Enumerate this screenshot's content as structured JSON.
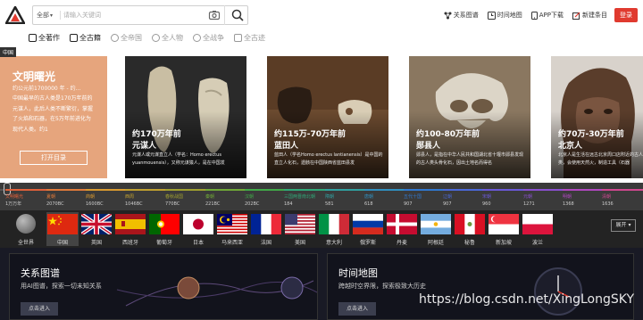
{
  "header": {
    "search": {
      "scope": "全部",
      "placeholder": "请输入关键词"
    },
    "nav": [
      {
        "label": "关系图谱",
        "icon": "graph-icon"
      },
      {
        "label": "时间地图",
        "icon": "clock-map-icon"
      },
      {
        "label": "APP下载",
        "icon": "phone-icon"
      },
      {
        "label": "新建条目",
        "icon": "edit-icon"
      }
    ],
    "login": "登录"
  },
  "filters": [
    {
      "label": "全著作",
      "active": true
    },
    {
      "label": "全古籍",
      "active": true
    },
    {
      "label": "全帝国",
      "active": false
    },
    {
      "label": "全人物",
      "active": false
    },
    {
      "label": "全战争",
      "active": false
    },
    {
      "label": "全古迹",
      "active": false
    }
  ],
  "region_tag": "中国",
  "feature": {
    "title": "文明曙光",
    "date": "约公元前1700000 年 - 约...",
    "desc": "中国最早的古人类是170万年前的元谋人，此后人类不断繁衍，掌握了火焰和石器，在5万年前进化为现代人类。约1",
    "button": "打开目录"
  },
  "cards": [
    {
      "time": "约170万年前",
      "name": "元谋人",
      "desc": "元谋人或元谋直立人（学名：Homo erectus yuanmouensis），又称元谋猿人，是在中国发"
    },
    {
      "time": "约115万-70万年前",
      "name": "蓝田人",
      "desc": "蓝田人（学名Homo erectus lantianensis）是中国的直立人化石，遗骸在中国陕西省蓝田县发"
    },
    {
      "time": "约100-80万年前",
      "name": "郧县人",
      "desc": "郧县人，是指在中华人民共和国湖北省十堰市郧县发现的古人类头骨化石，因出土地名而得名"
    },
    {
      "time": "约70万-30万年前",
      "name": "北京人",
      "desc": "北京人是生活在远古北京周口店附近的古人类，会使用天然火，制造工具（石器"
    }
  ],
  "timeline": [
    {
      "name": "文明曙光",
      "year": "1万万年",
      "color": "#e0603a"
    },
    {
      "name": "夏朝",
      "year": "2070BC",
      "color": "#e07a3a"
    },
    {
      "name": "商朝",
      "year": "1600BC",
      "color": "#d89a30"
    },
    {
      "name": "西周",
      "year": "1046BC",
      "color": "#c0a030"
    },
    {
      "name": "春秋战国",
      "year": "770BC",
      "color": "#a0a030"
    },
    {
      "name": "秦朝",
      "year": "221BC",
      "color": "#70a838"
    },
    {
      "name": "汉朝",
      "year": "202BC",
      "color": "#40a848"
    },
    {
      "name": "三国两晋南北朝",
      "year": "184",
      "color": "#30a878"
    },
    {
      "name": "隋朝",
      "year": "581",
      "color": "#30a0a0"
    },
    {
      "name": "唐朝",
      "year": "618",
      "color": "#3090c0"
    },
    {
      "name": "五代十国",
      "year": "907",
      "color": "#3078d0"
    },
    {
      "name": "辽朝",
      "year": "907",
      "color": "#4a68d8"
    },
    {
      "name": "宋朝",
      "year": "960",
      "color": "#6a58d8"
    },
    {
      "name": "元朝",
      "year": "1271",
      "color": "#8a50d0"
    },
    {
      "name": "明朝",
      "year": "1368",
      "color": "#b048c0"
    },
    {
      "name": "清朝",
      "year": "1636",
      "color": "#d04890"
    }
  ],
  "countries": {
    "all_label": "全世界",
    "items": [
      {
        "name": "中国",
        "flag": "china-flag-icon",
        "selected": true
      },
      {
        "name": "英国",
        "flag": "uk-flag-icon"
      },
      {
        "name": "西班牙",
        "flag": "spain-flag-icon"
      },
      {
        "name": "葡萄牙",
        "flag": "portugal-flag-icon"
      },
      {
        "name": "日本",
        "flag": "japan-flag-icon"
      },
      {
        "name": "马来西亚",
        "flag": "malaysia-flag-icon"
      },
      {
        "name": "法国",
        "flag": "france-flag-icon"
      },
      {
        "name": "美国",
        "flag": "usa-flag-icon"
      },
      {
        "name": "意大利",
        "flag": "italy-flag-icon"
      },
      {
        "name": "俄罗斯",
        "flag": "russia-flag-icon"
      },
      {
        "name": "丹麦",
        "flag": "denmark-flag-icon"
      },
      {
        "name": "阿根廷",
        "flag": "argentina-flag-icon"
      },
      {
        "name": "秘鲁",
        "flag": "peru-flag-icon"
      },
      {
        "name": "新加坡",
        "flag": "singapore-flag-icon"
      },
      {
        "name": "波兰",
        "flag": "poland-flag-icon"
      }
    ],
    "expand": "展开"
  },
  "panels": [
    {
      "title": "关系图谱",
      "desc": "用AI图谱，探索一切未知关系",
      "button": "点击进入"
    },
    {
      "title": "时间地图",
      "desc": "跨越时空界限，探索极致大历史",
      "button": "点击进入"
    }
  ],
  "watermark": "https://blog.csdn.net/XingLongSKY"
}
